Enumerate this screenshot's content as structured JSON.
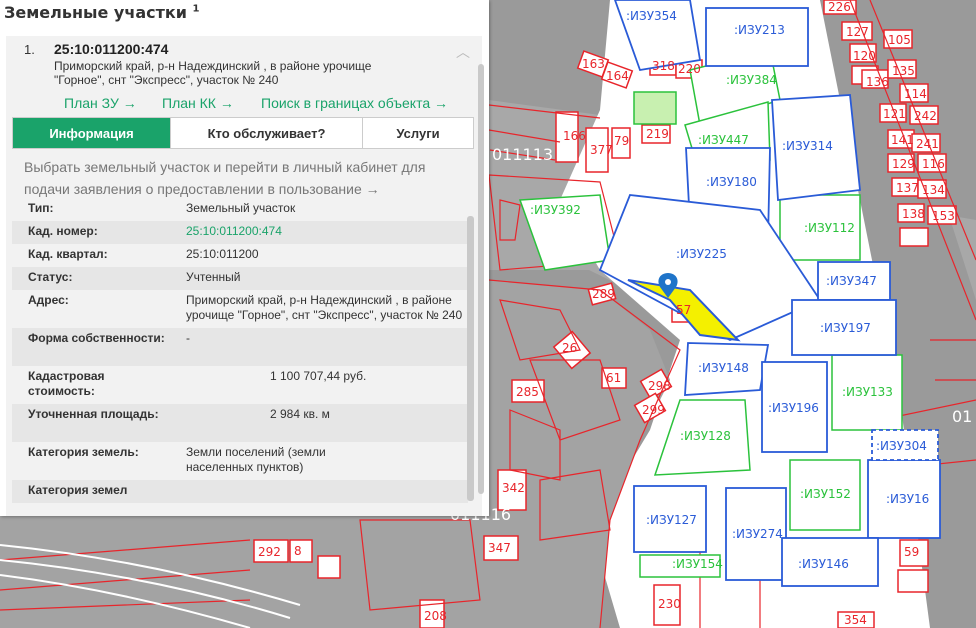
{
  "panel": {
    "title": "Земельные участки",
    "title_sup": "1",
    "item_number": "1.",
    "item_cadnum": "25:10:011200:474",
    "item_address": "Приморский край, р-н Надеждинский , в районе урочище \"Горное\", снт \"Экспресс\", участок № 240",
    "links": {
      "plan_zu": "План ЗУ →",
      "plan_kk": "План КК →",
      "search": "Поиск в границах объекта →"
    },
    "tabs": [
      "Информация",
      "Кто обслуживает?",
      "Услуги"
    ],
    "select_link": "Выбрать земельный участок и перейти в личный кабинет для подачи заявления о предоставлении в пользование →",
    "rows": [
      {
        "k": "Тип:",
        "v": "Земельный участок"
      },
      {
        "k": "Кад. номер:",
        "v": "25:10:011200:474"
      },
      {
        "k": "Кад. квартал:",
        "v": "25:10:011200"
      },
      {
        "k": "Статус:",
        "v": "Учтенный"
      },
      {
        "k": "Адрес:",
        "v": "Приморский край, р-н Надеждинский , в районе урочище \"Горное\", снт \"Экспресс\", участок № 240"
      },
      {
        "k": "Форма собственности:",
        "v": "-"
      },
      {
        "k": "Кадастровая стоимость:",
        "v": "1 100 707,44 руб."
      },
      {
        "k": "Уточненная площадь:",
        "v": "2 984 кв. м"
      },
      {
        "k": "Категория земель:",
        "v": "Земли поселений (земли населенных пунктов)"
      },
      {
        "k": "Категория земел",
        "v": ""
      }
    ]
  },
  "map": {
    "green_labels": [
      "ИЗУ384",
      "ИЗУ447",
      "ИЗУ392",
      "ИЗУ112",
      "ИЗУ133",
      "ИЗУ128",
      "ИЗУ152",
      "ИЗУ154"
    ],
    "blue_labels": [
      "ИЗУ354",
      "ИЗУ213",
      "ИЗУ314",
      "ИЗУ180",
      "ИЗУ225",
      "ИЗУ347",
      "ИЗУ197",
      "ИЗУ148",
      "ИЗУ196",
      "ИЗУ304",
      "ИЗУ16",
      "ИЗУ127",
      "ИЗУ274",
      "ИЗУ146"
    ],
    "numbers": [
      "226",
      "127",
      "105",
      "120",
      "135",
      "136",
      "114",
      "121",
      "242",
      "141",
      "241",
      "129",
      "116",
      "137",
      "134",
      "138",
      "153",
      "163",
      "164",
      "318",
      "220",
      "219",
      "166",
      "377",
      "79",
      "289",
      "57",
      "26",
      "285",
      "61",
      "298",
      "299",
      "342",
      "347",
      "292",
      "8",
      "230",
      "208",
      "59",
      "354",
      "0111",
      "01"
    ],
    "quarter_labels": [
      "011113",
      "011116"
    ],
    "colors": {
      "background": "#9a9a9a",
      "parcel_fill": "#ffffff",
      "parcel_border": "#e8252b",
      "green": "#2bc23c",
      "blue": "#2a5bd7",
      "selected": "#f4f000",
      "marker": "#1f74c9",
      "link": "#1aa36a"
    }
  }
}
